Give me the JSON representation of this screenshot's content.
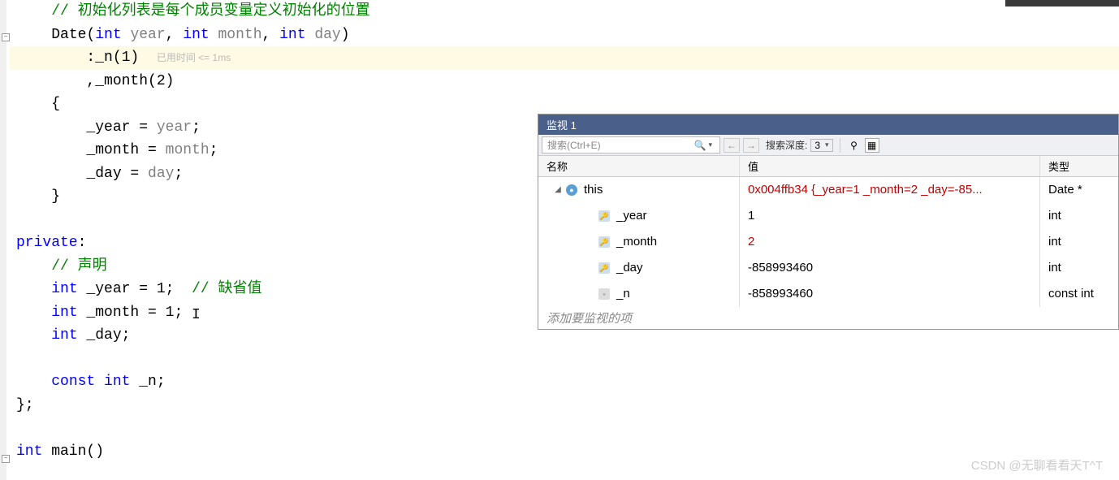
{
  "code": {
    "line1_comment": "// 初始化列表是每个成员变量定义初始化的位置",
    "line2_ctor": "Date",
    "line2_p1t": "int",
    "line2_p1": " year",
    "line2_p2t": "int",
    "line2_p2": " month",
    "line2_p3t": "int",
    "line2_p3": " day",
    "line3_init": ":_n(1)",
    "line3_hint": "已用时间 <= 1ms",
    "line4_init": ",_month(2)",
    "line5_brace": "{",
    "line6_assign_l": "_year = ",
    "line6_assign_r": "year",
    "line7_assign_l": "_month = ",
    "line7_assign_r": "month",
    "line8_assign_l": "_day = ",
    "line8_assign_r": "day",
    "line9_brace": "}",
    "line11_private": "private",
    "line12_comment": "// 声明",
    "line13_t": "int",
    "line13_rest": " _year = 1;  ",
    "line13_comment": "// 缺省值",
    "line14_t": "int",
    "line14_rest": " _month = 1;",
    "line15_t": "int",
    "line15_rest": " _day;",
    "line17_const": "const ",
    "line17_t": "int",
    "line17_rest": " _n;",
    "line18_close": "};",
    "line20_t": "int",
    "line20_main": " main()"
  },
  "watch": {
    "title": "监视 1",
    "search_placeholder": "搜索(Ctrl+E)",
    "depth_label": "搜索深度:",
    "depth_value": "3",
    "columns": {
      "name": "名称",
      "value": "值",
      "type": "类型"
    },
    "rows": [
      {
        "indent": 0,
        "expander": "◢",
        "icon": "circle",
        "name": "this",
        "value": "0x004ffb34 {_year=1 _month=2 _day=-85...",
        "type": "Date *",
        "value_red": true
      },
      {
        "indent": 1,
        "expander": "",
        "icon": "key",
        "name": "_year",
        "value": "1",
        "type": "int",
        "value_red": false
      },
      {
        "indent": 1,
        "expander": "",
        "icon": "key",
        "name": "_month",
        "value": "2",
        "type": "int",
        "value_red": true
      },
      {
        "indent": 1,
        "expander": "",
        "icon": "key",
        "name": "_day",
        "value": "-858993460",
        "type": "int",
        "value_red": false
      },
      {
        "indent": 1,
        "expander": "",
        "icon": "const",
        "name": "_n",
        "value": "-858993460",
        "type": "const int",
        "value_red": false
      }
    ],
    "add_prompt": "添加要监视的项"
  },
  "watermark": "CSDN @无聊看看天T^T"
}
